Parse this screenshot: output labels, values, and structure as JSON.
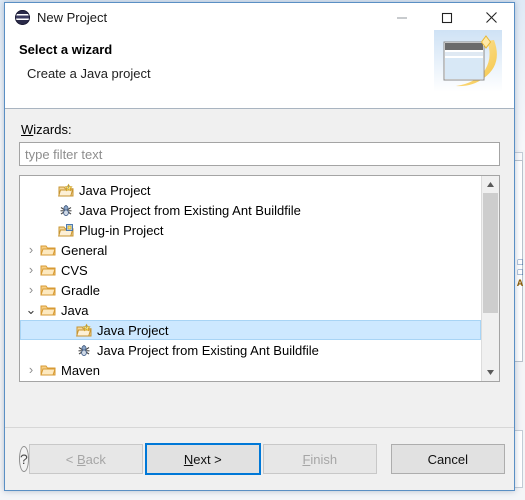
{
  "window": {
    "title": "New Project",
    "app_icon": "eclipse-icon",
    "controls": {
      "minimize": "minimize-icon",
      "maximize": "maximize-icon",
      "close": "close-icon"
    }
  },
  "header": {
    "title": "Select a wizard",
    "subtitle": "Create a Java project",
    "banner_icon": "wizard-banner-icon"
  },
  "form": {
    "wizards_label": "Wizards:",
    "wizards_label_mnemonic": "W",
    "wizards_label_rest": "izards:",
    "filter": {
      "value": "",
      "placeholder": "type filter text"
    }
  },
  "tree": {
    "items": [
      {
        "label": "Java Project",
        "icon": "java-project-icon",
        "indent": 1,
        "twisty": "none",
        "selected": false
      },
      {
        "label": "Java Project from Existing Ant Buildfile",
        "icon": "ant-buildfile-icon",
        "indent": 1,
        "twisty": "none",
        "selected": false
      },
      {
        "label": "Plug-in Project",
        "icon": "plugin-project-icon",
        "indent": 1,
        "twisty": "none",
        "selected": false
      },
      {
        "label": "General",
        "icon": "folder-icon",
        "indent": 0,
        "twisty": "collapsed",
        "selected": false
      },
      {
        "label": "CVS",
        "icon": "folder-icon",
        "indent": 0,
        "twisty": "collapsed",
        "selected": false
      },
      {
        "label": "Gradle",
        "icon": "folder-icon",
        "indent": 0,
        "twisty": "collapsed",
        "selected": false
      },
      {
        "label": "Java",
        "icon": "folder-icon",
        "indent": 0,
        "twisty": "expanded",
        "selected": false
      },
      {
        "label": "Java Project",
        "icon": "java-project-icon",
        "indent": 2,
        "twisty": "none",
        "selected": true
      },
      {
        "label": "Java Project from Existing Ant Buildfile",
        "icon": "ant-buildfile-icon",
        "indent": 2,
        "twisty": "none",
        "selected": false
      },
      {
        "label": "Maven",
        "icon": "folder-icon",
        "indent": 0,
        "twisty": "collapsed",
        "selected": false
      }
    ],
    "scrollbar": {
      "up_arrow": "chevron-up-icon",
      "down_arrow": "chevron-down-icon",
      "thumb_fraction": 0.7
    }
  },
  "footer": {
    "help_label": "?",
    "buttons": [
      {
        "name": "back",
        "label": "< Back",
        "mnemonic": "B",
        "state": "disabled"
      },
      {
        "name": "next",
        "label": "Next >",
        "mnemonic": "N",
        "state": "focused"
      },
      {
        "name": "finish",
        "label": "Finish",
        "mnemonic": "F",
        "state": "disabled"
      },
      {
        "name": "cancel",
        "label": "Cancel",
        "mnemonic": "",
        "state": "enabled"
      }
    ]
  },
  "background": {
    "text_a": "□",
    "text_b": "□",
    "text_c": "A"
  },
  "colors": {
    "selection": "#cde8ff",
    "focus_border": "#0078d7",
    "window_border": "#5a8fc4",
    "folder": "#e9a83a"
  }
}
